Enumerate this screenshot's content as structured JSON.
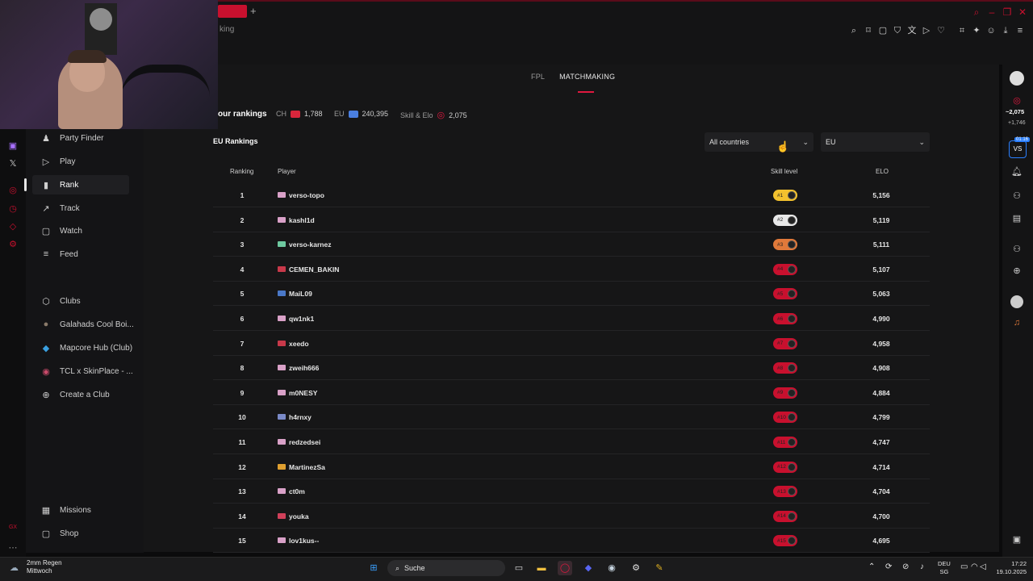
{
  "browser": {
    "tab_fragment": "king",
    "new_tab": "+"
  },
  "sidebar": {
    "items": [
      {
        "label": "Party Finder",
        "icon": "party-finder-icon",
        "glyph": "♟"
      },
      {
        "label": "Play",
        "icon": "play-icon",
        "glyph": "▷"
      },
      {
        "label": "Rank",
        "icon": "rank-icon",
        "glyph": "▮"
      },
      {
        "label": "Track",
        "icon": "track-icon",
        "glyph": "↗"
      },
      {
        "label": "Watch",
        "icon": "watch-icon",
        "glyph": "▢"
      },
      {
        "label": "Feed",
        "icon": "feed-icon",
        "glyph": "≡"
      }
    ],
    "clubs": [
      {
        "label": "Clubs",
        "icon": "clubs-icon",
        "glyph": "⬡"
      },
      {
        "label": "Galahads Cool Boi...",
        "icon": "club-avatar-icon",
        "glyph": "●"
      },
      {
        "label": "Mapcore Hub (Club)",
        "icon": "club-avatar-icon",
        "glyph": "◆"
      },
      {
        "label": "TCL x SkinPlace - ...",
        "icon": "club-avatar-icon",
        "glyph": "◉"
      },
      {
        "label": "Create a Club",
        "icon": "plus-circle-icon",
        "glyph": "⊕"
      }
    ],
    "bottom": [
      {
        "label": "Missions",
        "icon": "missions-icon",
        "glyph": "▦"
      },
      {
        "label": "Shop",
        "icon": "shop-icon",
        "glyph": "▢"
      }
    ]
  },
  "tabs": {
    "fpl": "FPL",
    "matchmaking": "MATCHMAKING"
  },
  "your_rankings": {
    "title": "our rankings",
    "ch_label": "CH",
    "ch_value": "1,788",
    "eu_label": "EU",
    "eu_value": "240,395",
    "skill_label": "Skill & Elo",
    "skill_value": "2,075"
  },
  "eu_rankings": {
    "title": "EU Rankings",
    "country_select": "All countries",
    "region_select": "EU"
  },
  "table": {
    "headers": {
      "ranking": "Ranking",
      "player": "Player",
      "skill": "Skill level",
      "elo": "ELO"
    },
    "rows": [
      {
        "rank": "1",
        "player": "verso-topo",
        "badge": "#1",
        "elo": "5,156",
        "flag": "#d9a1c8",
        "badge_color": "#f2c12e"
      },
      {
        "rank": "2",
        "player": "kashl1d",
        "badge": "#2",
        "elo": "5,119",
        "flag": "#d9a1c8",
        "badge_color": "#e8e8e8"
      },
      {
        "rank": "3",
        "player": "verso-karnez",
        "badge": "#3",
        "elo": "5,111",
        "flag": "#6ec9a0",
        "badge_color": "#e0793a"
      },
      {
        "rank": "4",
        "player": "CEMEN_BAKIN",
        "badge": "#4",
        "elo": "5,107",
        "flag": "#c8394a",
        "badge_color": "#c8102e"
      },
      {
        "rank": "5",
        "player": "MaiL09",
        "badge": "#5",
        "elo": "5,063",
        "flag": "#4a78c8",
        "badge_color": "#c8102e"
      },
      {
        "rank": "6",
        "player": "qw1nk1",
        "badge": "#6",
        "elo": "4,990",
        "flag": "#d9a1c8",
        "badge_color": "#c8102e"
      },
      {
        "rank": "7",
        "player": "xeedo",
        "badge": "#7",
        "elo": "4,958",
        "flag": "#c8394a",
        "badge_color": "#c8102e"
      },
      {
        "rank": "8",
        "player": "zweih666",
        "badge": "#8",
        "elo": "4,908",
        "flag": "#d9a1c8",
        "badge_color": "#c8102e"
      },
      {
        "rank": "9",
        "player": "m0NESY",
        "badge": "#9",
        "elo": "4,884",
        "flag": "#d9a1c8",
        "badge_color": "#c8102e"
      },
      {
        "rank": "10",
        "player": "h4rnxy",
        "badge": "#10",
        "elo": "4,799",
        "flag": "#7a8ac8",
        "badge_color": "#c8102e"
      },
      {
        "rank": "11",
        "player": "redzedsei",
        "badge": "#11",
        "elo": "4,747",
        "flag": "#d9a1c8",
        "badge_color": "#c8102e"
      },
      {
        "rank": "12",
        "player": "MartinezSa",
        "badge": "#12",
        "elo": "4,714",
        "flag": "#e0a030",
        "badge_color": "#c8102e"
      },
      {
        "rank": "13",
        "player": "ct0m",
        "badge": "#13",
        "elo": "4,704",
        "flag": "#d9a1c8",
        "badge_color": "#c8102e"
      },
      {
        "rank": "14",
        "player": "youka",
        "badge": "#14",
        "elo": "4,700",
        "flag": "#d0405a",
        "badge_color": "#c8102e"
      },
      {
        "rank": "15",
        "player": "lov1kus--",
        "badge": "#15",
        "elo": "4,695",
        "flag": "#d9a1c8",
        "badge_color": "#c8102e"
      }
    ]
  },
  "right_rail": {
    "elo": "~2,075",
    "elo_delta": "+1,746",
    "vs_timer": "01:16",
    "vs": "VS"
  },
  "taskbar": {
    "weather_temp": "2mm Regen",
    "weather_day": "Mittwoch",
    "search": "Suche",
    "lang": "DEU",
    "lang2": "SG",
    "time": "17:22",
    "date": "19.10.2025"
  },
  "colors": {
    "accent": "#e0183f",
    "bg": "#161617",
    "row_border": "#242426"
  }
}
